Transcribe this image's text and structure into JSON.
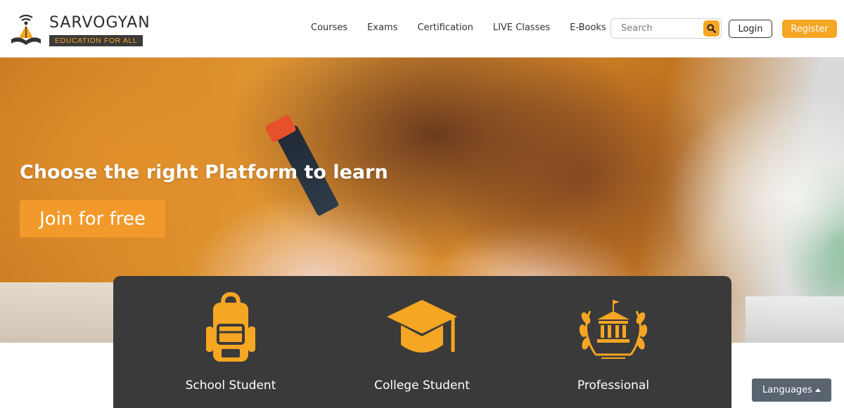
{
  "brand": {
    "name": "SARVOGYAN",
    "tagline": "EDUCATION FOR ALL",
    "logo_icon": "lamp-book-icon"
  },
  "nav": {
    "items": [
      {
        "label": "Courses"
      },
      {
        "label": "Exams"
      },
      {
        "label": "Certification"
      },
      {
        "label": "LIVE Classes"
      },
      {
        "label": "E-Books"
      }
    ]
  },
  "search": {
    "placeholder": "Search",
    "icon": "search-icon"
  },
  "auth": {
    "login_label": "Login",
    "register_label": "Register"
  },
  "hero": {
    "title": "Choose the right Platform to learn",
    "cta_label": "Join for free"
  },
  "categories": [
    {
      "label": "School Student",
      "icon": "backpack-icon"
    },
    {
      "label": "College Student",
      "icon": "graduation-cap-icon"
    },
    {
      "label": "Professional",
      "icon": "institution-laurel-icon"
    }
  ],
  "languages": {
    "label": "Languages",
    "icon": "caret-up-icon"
  },
  "colors": {
    "accent": "#f5a623",
    "dark_panel": "#3a3a3a",
    "language_button": "#5a6470"
  }
}
